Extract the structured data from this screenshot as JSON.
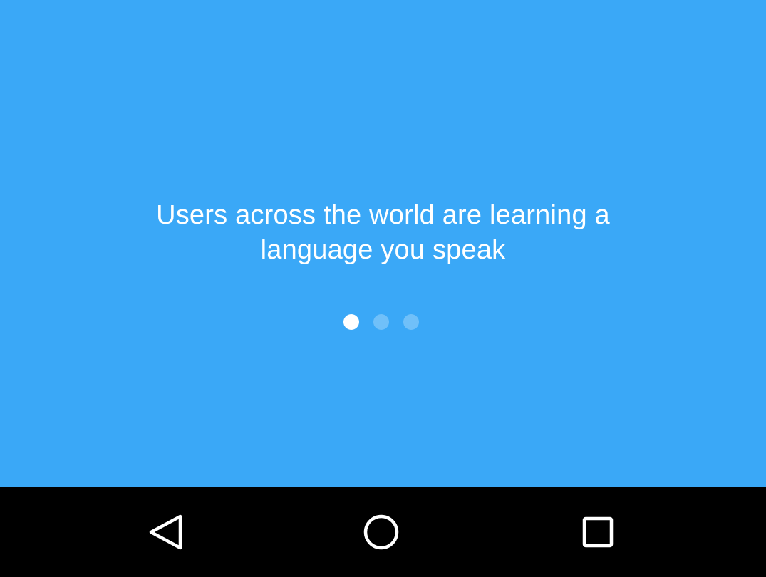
{
  "onboarding": {
    "background_color": "#3aa8f7",
    "message_line1": "Users across the world are learning a",
    "message_line2": "language you speak",
    "pager": {
      "total_pages": 3,
      "current_page": 1
    }
  },
  "navbar": {
    "background_color": "#000000",
    "buttons": [
      {
        "icon": "back-icon"
      },
      {
        "icon": "home-icon"
      },
      {
        "icon": "recents-icon"
      }
    ]
  }
}
